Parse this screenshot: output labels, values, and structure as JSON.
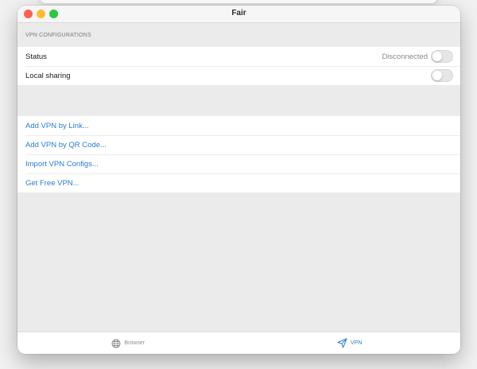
{
  "window": {
    "title": "Fair"
  },
  "traffic_lights": {
    "close_color": "#fe5f57",
    "minimize_color": "#febc2e",
    "zoom_color": "#28c840"
  },
  "vpn_section": {
    "header": "VPN CONFIGURATIONS",
    "status_label": "Status",
    "status_value": "Disconnected",
    "status_toggle_on": false,
    "local_sharing_label": "Local sharing",
    "local_sharing_toggle_on": false
  },
  "actions": [
    {
      "label": "Add VPN by Link..."
    },
    {
      "label": "Add VPN by QR Code..."
    },
    {
      "label": "Import VPN Configs..."
    },
    {
      "label": "Get Free VPN..."
    }
  ],
  "tabs": [
    {
      "label": "Browser",
      "icon": "globe-icon",
      "active": false
    },
    {
      "label": "VPN",
      "icon": "paper-plane-icon",
      "active": true
    }
  ],
  "colors": {
    "accent": "#2b7bd8",
    "inactive_tab": "#8e8e8e"
  }
}
